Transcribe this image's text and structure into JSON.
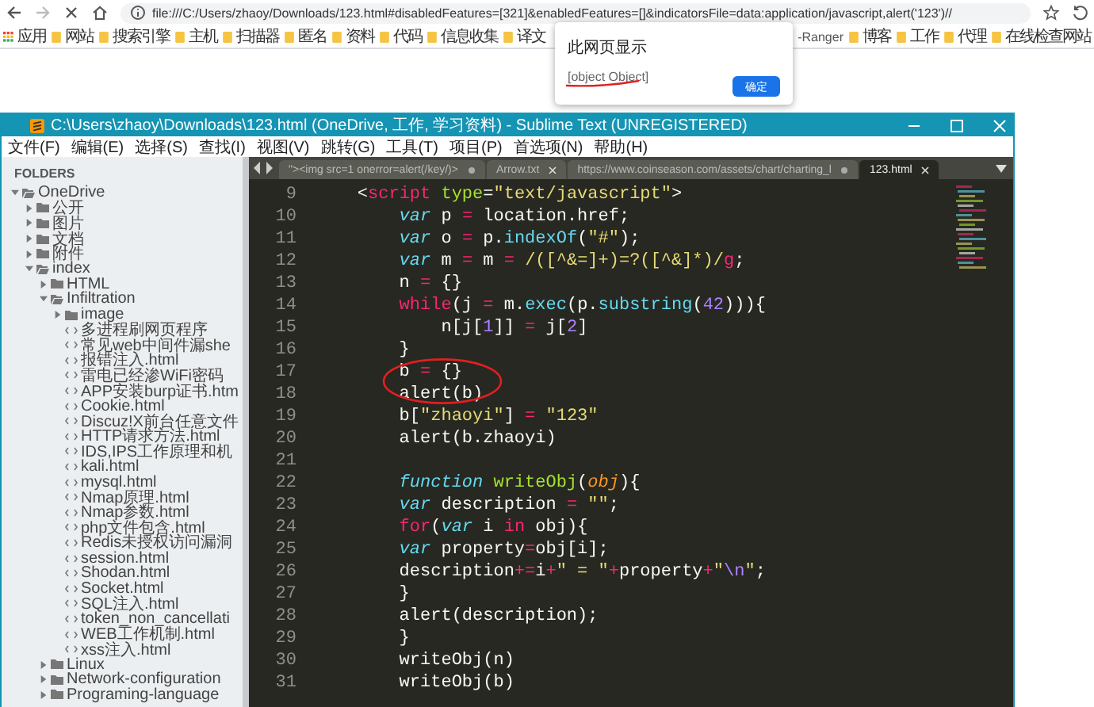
{
  "browser": {
    "address": "file:///C:/Users/zhaoy/Downloads/123.html#disabledFeatures=[321]&enabledFeatures=[]&indicatorsFile=data:application/javascript,alert('123')//",
    "bookmarks_left": [
      {
        "label": "应用",
        "kind": "apps"
      },
      {
        "label": "网站",
        "kind": "folder"
      },
      {
        "label": "搜索引擎",
        "kind": "folder"
      },
      {
        "label": "主机",
        "kind": "folder"
      },
      {
        "label": "扫描器",
        "kind": "folder"
      },
      {
        "label": "匿名",
        "kind": "folder"
      },
      {
        "label": "资料",
        "kind": "folder"
      },
      {
        "label": "代码",
        "kind": "folder"
      },
      {
        "label": "信息收集",
        "kind": "folder"
      },
      {
        "label": "译文",
        "kind": "folder"
      }
    ],
    "bookmarks_right": [
      {
        "label": "-Ranger",
        "kind": "text"
      },
      {
        "label": "博客",
        "kind": "folder"
      },
      {
        "label": "工作",
        "kind": "folder"
      },
      {
        "label": "代理",
        "kind": "folder"
      },
      {
        "label": "在线检查网站",
        "kind": "folder"
      }
    ]
  },
  "dialog": {
    "title": "此网页显示",
    "message": "[object Object]",
    "button": "确定"
  },
  "editor_window": {
    "title": "C:\\Users\\zhaoy\\Downloads\\123.html (OneDrive, 工作, 学习资料) - Sublime Text (UNREGISTERED)",
    "menu": [
      "文件(F)",
      "编辑(E)",
      "选择(S)",
      "查找(I)",
      "视图(V)",
      "跳转(G)",
      "工具(T)",
      "项目(P)",
      "首选项(N)",
      "帮助(H)"
    ],
    "sidebar": {
      "header": "FOLDERS",
      "tree": [
        {
          "label": "OneDrive",
          "kind": "folder",
          "expanded": true,
          "children": [
            {
              "label": "公开",
              "kind": "folder",
              "expanded": false
            },
            {
              "label": "图片",
              "kind": "folder",
              "expanded": false
            },
            {
              "label": "文档",
              "kind": "folder",
              "expanded": false
            },
            {
              "label": "附件",
              "kind": "folder",
              "expanded": false
            },
            {
              "label": "index",
              "kind": "folder",
              "expanded": true,
              "children": [
                {
                  "label": "HTML",
                  "kind": "folder",
                  "expanded": false
                },
                {
                  "label": "Infiltration",
                  "kind": "folder",
                  "expanded": true,
                  "children": [
                    {
                      "label": "image",
                      "kind": "folder",
                      "expanded": false
                    },
                    {
                      "label": "多进程刷网页程序",
                      "kind": "file"
                    },
                    {
                      "label": "常见web中间件漏she",
                      "kind": "file"
                    },
                    {
                      "label": "报错注入.html",
                      "kind": "file"
                    },
                    {
                      "label": "雷电已经渗WiFi密码",
                      "kind": "file"
                    },
                    {
                      "label": "APP安装burp证书.htm",
                      "kind": "file"
                    },
                    {
                      "label": "Cookie.html",
                      "kind": "file"
                    },
                    {
                      "label": "Discuz!X前台任意文件",
                      "kind": "file"
                    },
                    {
                      "label": "HTTP请求方法.html",
                      "kind": "file"
                    },
                    {
                      "label": "IDS,IPS工作原理和机",
                      "kind": "file"
                    },
                    {
                      "label": "kali.html",
                      "kind": "file"
                    },
                    {
                      "label": "mysql.html",
                      "kind": "file"
                    },
                    {
                      "label": "Nmap原理.html",
                      "kind": "file"
                    },
                    {
                      "label": "Nmap参数.html",
                      "kind": "file"
                    },
                    {
                      "label": "php文件包含.html",
                      "kind": "file"
                    },
                    {
                      "label": "Redis未授权访问漏洞",
                      "kind": "file"
                    },
                    {
                      "label": "session.html",
                      "kind": "file"
                    },
                    {
                      "label": "Shodan.html",
                      "kind": "file"
                    },
                    {
                      "label": "Socket.html",
                      "kind": "file"
                    },
                    {
                      "label": "SQL注入.html",
                      "kind": "file"
                    },
                    {
                      "label": "token_non_cancellati",
                      "kind": "file"
                    },
                    {
                      "label": "WEB工作机制.html",
                      "kind": "file"
                    },
                    {
                      "label": "xss注入.html",
                      "kind": "file"
                    }
                  ]
                },
                {
                  "label": "Linux",
                  "kind": "folder",
                  "expanded": false
                },
                {
                  "label": "Network-configuration",
                  "kind": "folder",
                  "expanded": false
                },
                {
                  "label": "Programing-language",
                  "kind": "folder",
                  "expanded": false
                }
              ]
            }
          ]
        }
      ]
    },
    "tabs": [
      {
        "label": "\"><img src=1 onerror=alert(/key/)>",
        "selected": false,
        "modified": true
      },
      {
        "label": "Arrow.txt",
        "selected": false,
        "modified": false
      },
      {
        "label": "https://www.coinseason.com/assets/chart/charting_l",
        "selected": false,
        "modified": true
      },
      {
        "label": "123.html",
        "selected": true,
        "modified": false
      }
    ],
    "code": [
      {
        "number": "9",
        "tokens": [
          {
            "text": "    <",
            "kind": "plain"
          },
          {
            "text": "script",
            "kind": "tag"
          },
          {
            "text": " type",
            "kind": "attr"
          },
          {
            "text": "=",
            "kind": "plain"
          },
          {
            "text": "\"text/javascript\"",
            "kind": "string"
          },
          {
            "text": ">",
            "kind": "plain"
          }
        ]
      },
      {
        "number": "10",
        "tokens": [
          {
            "text": "        var",
            "kind": "storage"
          },
          {
            "text": " p ",
            "kind": "plain"
          },
          {
            "text": "=",
            "kind": "operator"
          },
          {
            "text": " location.href;",
            "kind": "plain"
          }
        ]
      },
      {
        "number": "11",
        "tokens": [
          {
            "text": "        var",
            "kind": "storage"
          },
          {
            "text": " o ",
            "kind": "plain"
          },
          {
            "text": "=",
            "kind": "operator"
          },
          {
            "text": " p.",
            "kind": "plain"
          },
          {
            "text": "indexOf",
            "kind": "support"
          },
          {
            "text": "(",
            "kind": "plain"
          },
          {
            "text": "\"#\"",
            "kind": "string"
          },
          {
            "text": ");",
            "kind": "plain"
          }
        ]
      },
      {
        "number": "12",
        "tokens": [
          {
            "text": "        var",
            "kind": "storage"
          },
          {
            "text": " m ",
            "kind": "plain"
          },
          {
            "text": "=",
            "kind": "operator"
          },
          {
            "text": " m ",
            "kind": "plain"
          },
          {
            "text": "=",
            "kind": "operator"
          },
          {
            "text": " /([^&=]+)=?([^&]*)/",
            "kind": "string"
          },
          {
            "text": "g",
            "kind": "keyword"
          },
          {
            "text": ";",
            "kind": "plain"
          }
        ]
      },
      {
        "number": "13",
        "tokens": [
          {
            "text": "        n ",
            "kind": "plain"
          },
          {
            "text": "=",
            "kind": "operator"
          },
          {
            "text": " {}",
            "kind": "plain"
          }
        ]
      },
      {
        "number": "14",
        "tokens": [
          {
            "text": "        while",
            "kind": "keyword"
          },
          {
            "text": "(j ",
            "kind": "plain"
          },
          {
            "text": "=",
            "kind": "operator"
          },
          {
            "text": " m.",
            "kind": "plain"
          },
          {
            "text": "exec",
            "kind": "support"
          },
          {
            "text": "(p.",
            "kind": "plain"
          },
          {
            "text": "substring",
            "kind": "support"
          },
          {
            "text": "(",
            "kind": "plain"
          },
          {
            "text": "42",
            "kind": "number"
          },
          {
            "text": "))){",
            "kind": "plain"
          }
        ]
      },
      {
        "number": "15",
        "tokens": [
          {
            "text": "            n[j[",
            "kind": "plain"
          },
          {
            "text": "1",
            "kind": "number"
          },
          {
            "text": "]] ",
            "kind": "plain"
          },
          {
            "text": "=",
            "kind": "operator"
          },
          {
            "text": " j[",
            "kind": "plain"
          },
          {
            "text": "2",
            "kind": "number"
          },
          {
            "text": "]",
            "kind": "plain"
          }
        ]
      },
      {
        "number": "16",
        "tokens": [
          {
            "text": "        }",
            "kind": "plain"
          }
        ]
      },
      {
        "number": "17",
        "tokens": [
          {
            "text": "        b ",
            "kind": "plain"
          },
          {
            "text": "=",
            "kind": "operator"
          },
          {
            "text": " {}",
            "kind": "plain"
          }
        ]
      },
      {
        "number": "18",
        "tokens": [
          {
            "text": "        alert(b)",
            "kind": "plain"
          }
        ]
      },
      {
        "number": "19",
        "tokens": [
          {
            "text": "        b[",
            "kind": "plain"
          },
          {
            "text": "\"zhaoyi\"",
            "kind": "string"
          },
          {
            "text": "] ",
            "kind": "plain"
          },
          {
            "text": "=",
            "kind": "operator"
          },
          {
            "text": " \"123\"",
            "kind": "string"
          }
        ]
      },
      {
        "number": "20",
        "tokens": [
          {
            "text": "        alert(b.zhaoyi)",
            "kind": "plain"
          }
        ]
      },
      {
        "number": "21"
      },
      {
        "number": "22",
        "tokens": [
          {
            "text": "        function",
            "kind": "storage"
          },
          {
            "text": " writeObj",
            "kind": "entity"
          },
          {
            "text": "(",
            "kind": "plain"
          },
          {
            "text": "obj",
            "kind": "param"
          },
          {
            "text": "){",
            "kind": "plain"
          }
        ]
      },
      {
        "number": "23",
        "tokens": [
          {
            "text": "        var",
            "kind": "storage"
          },
          {
            "text": " description ",
            "kind": "plain"
          },
          {
            "text": "=",
            "kind": "operator"
          },
          {
            "text": " \"\"",
            "kind": "string"
          },
          {
            "text": ";",
            "kind": "plain"
          }
        ]
      },
      {
        "number": "24",
        "tokens": [
          {
            "text": "        for",
            "kind": "keyword"
          },
          {
            "text": "(",
            "kind": "plain"
          },
          {
            "text": "var",
            "kind": "storage"
          },
          {
            "text": " i ",
            "kind": "plain"
          },
          {
            "text": "in",
            "kind": "keyword"
          },
          {
            "text": " obj){",
            "kind": "plain"
          }
        ]
      },
      {
        "number": "25",
        "tokens": [
          {
            "text": "        var",
            "kind": "storage"
          },
          {
            "text": " property",
            "kind": "plain"
          },
          {
            "text": "=",
            "kind": "operator"
          },
          {
            "text": "obj[i];",
            "kind": "plain"
          }
        ]
      },
      {
        "number": "26",
        "tokens": [
          {
            "text": "        description",
            "kind": "plain"
          },
          {
            "text": "+=",
            "kind": "operator"
          },
          {
            "text": "i",
            "kind": "plain"
          },
          {
            "text": "+",
            "kind": "operator"
          },
          {
            "text": "\" = \"",
            "kind": "string"
          },
          {
            "text": "+",
            "kind": "operator"
          },
          {
            "text": "property",
            "kind": "plain"
          },
          {
            "text": "+",
            "kind": "operator"
          },
          {
            "text": "\"",
            "kind": "string"
          },
          {
            "text": "\\n",
            "kind": "number"
          },
          {
            "text": "\"",
            "kind": "string"
          },
          {
            "text": ";",
            "kind": "plain"
          }
        ]
      },
      {
        "number": "27",
        "tokens": [
          {
            "text": "        }",
            "kind": "plain"
          }
        ]
      },
      {
        "number": "28",
        "tokens": [
          {
            "text": "        alert(description);",
            "kind": "plain"
          }
        ]
      },
      {
        "number": "29",
        "tokens": [
          {
            "text": "        }",
            "kind": "plain"
          }
        ]
      },
      {
        "number": "30",
        "tokens": [
          {
            "text": "        writeObj(n)",
            "kind": "plain"
          }
        ]
      },
      {
        "number": "31",
        "tokens": [
          {
            "text": "        writeObj(b)",
            "kind": "plain"
          }
        ]
      }
    ]
  }
}
